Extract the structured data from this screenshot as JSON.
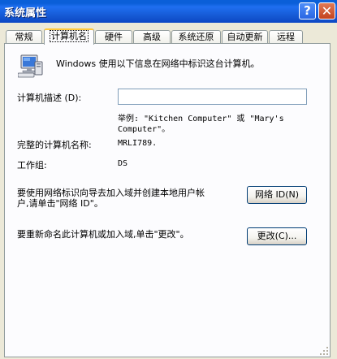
{
  "window": {
    "title": "系统属性",
    "help_glyph": "?",
    "close_glyph": "✕"
  },
  "tabs": [
    {
      "label": "常规"
    },
    {
      "label": "计算机名"
    },
    {
      "label": "硬件"
    },
    {
      "label": "高级"
    },
    {
      "label": "系统还原"
    },
    {
      "label": "自动更新"
    },
    {
      "label": "远程"
    }
  ],
  "active_tab": "计算机名",
  "intro": "Windows 使用以下信息在网络中标识这台计算机。",
  "description": {
    "label": "计算机描述 (D):",
    "value": "",
    "example_line1": "举例: \"Kitchen Computer\" 或 \"Mary's",
    "example_line2": "Computer\"。"
  },
  "full_name": {
    "label": "完整的计算机名称:",
    "value": "MRLI789."
  },
  "workgroup": {
    "label": "工作组:",
    "value": "DS"
  },
  "network_id": {
    "text_line1": "要使用网络标识向导去加入域并创建本地用户帐",
    "text_line2": "户,请单击\"网络 ID\"。",
    "button_label": "网络 ID(N)"
  },
  "rename": {
    "text": "要重新命名此计算机或加入域,单击\"更改\"。",
    "button_label": "更改(C)..."
  },
  "icons": {
    "computer": "computer-icon",
    "grip": "resize-grip-icon"
  }
}
